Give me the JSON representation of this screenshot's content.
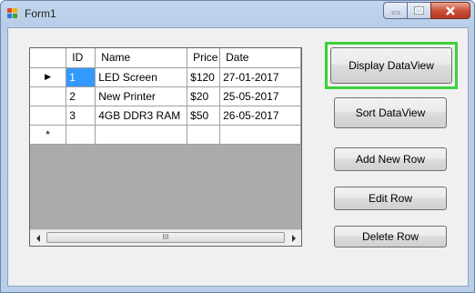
{
  "window": {
    "title": "Form1"
  },
  "grid": {
    "columns": [
      "ID",
      "Name",
      "Price",
      "Date"
    ],
    "rows": [
      {
        "indicator": "▶",
        "cells": [
          "1",
          "LED Screen",
          "$120",
          "27-01-2017"
        ]
      },
      {
        "indicator": "",
        "cells": [
          "2",
          "New Printer",
          "$20",
          "25-05-2017"
        ]
      },
      {
        "indicator": "",
        "cells": [
          "3",
          "4GB DDR3 RAM",
          "$50",
          "26-05-2017"
        ]
      }
    ],
    "new_row_indicator": "*",
    "scroll_thumb_label": "III"
  },
  "buttons": {
    "display": "Display DataView",
    "sort": "Sort DataView",
    "add": "Add New Row",
    "edit": "Edit Row",
    "delete": "Delete Row"
  },
  "colors": {
    "focus_highlight": "#3ad13a",
    "selection": "#3399ff"
  }
}
